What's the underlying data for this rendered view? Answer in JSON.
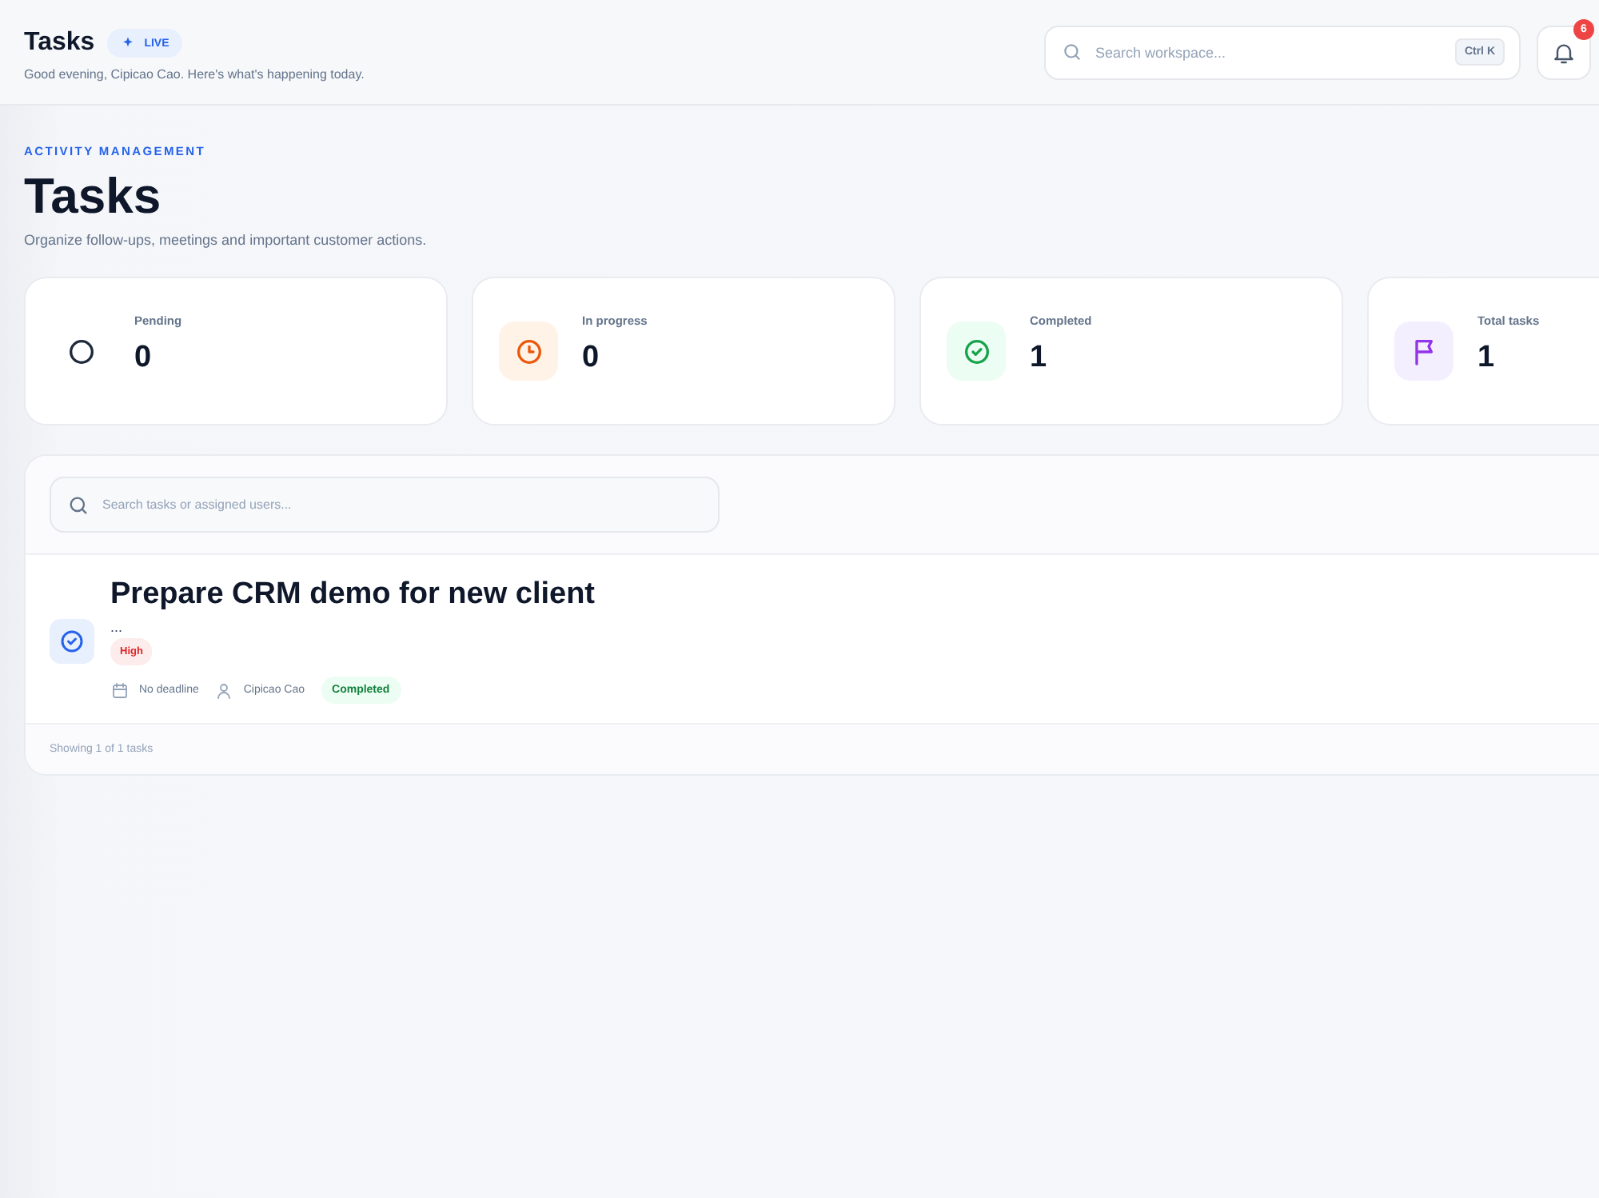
{
  "header": {
    "title": "Tasks",
    "live_badge": "LIVE",
    "greeting": "Good evening, Cipicao Cao. Here's what's happening today.",
    "search": {
      "placeholder": "Search workspace...",
      "shortcut": "Ctrl K"
    },
    "notifications": "6"
  },
  "page": {
    "eyebrow": "ACTIVITY MANAGEMENT",
    "title": "Tasks",
    "subtitle": "Organize follow-ups, meetings and important customer actions."
  },
  "stats": [
    {
      "kind": "pending",
      "label": "Pending",
      "value": "0"
    },
    {
      "kind": "progress",
      "label": "In progress",
      "value": "0"
    },
    {
      "kind": "completed",
      "label": "Completed",
      "value": "1"
    },
    {
      "kind": "total",
      "label": "Total tasks",
      "value": "1"
    }
  ],
  "task_search": {
    "placeholder": "Search tasks or assigned users..."
  },
  "tasks": [
    {
      "title": "Prepare CRM demo for new client",
      "description": "...",
      "priority": "High",
      "deadline": "No deadline",
      "assignee": "Cipicao Cao",
      "status": "Completed",
      "completed": true
    }
  ],
  "footer": "Showing 1 of 1 tasks"
}
